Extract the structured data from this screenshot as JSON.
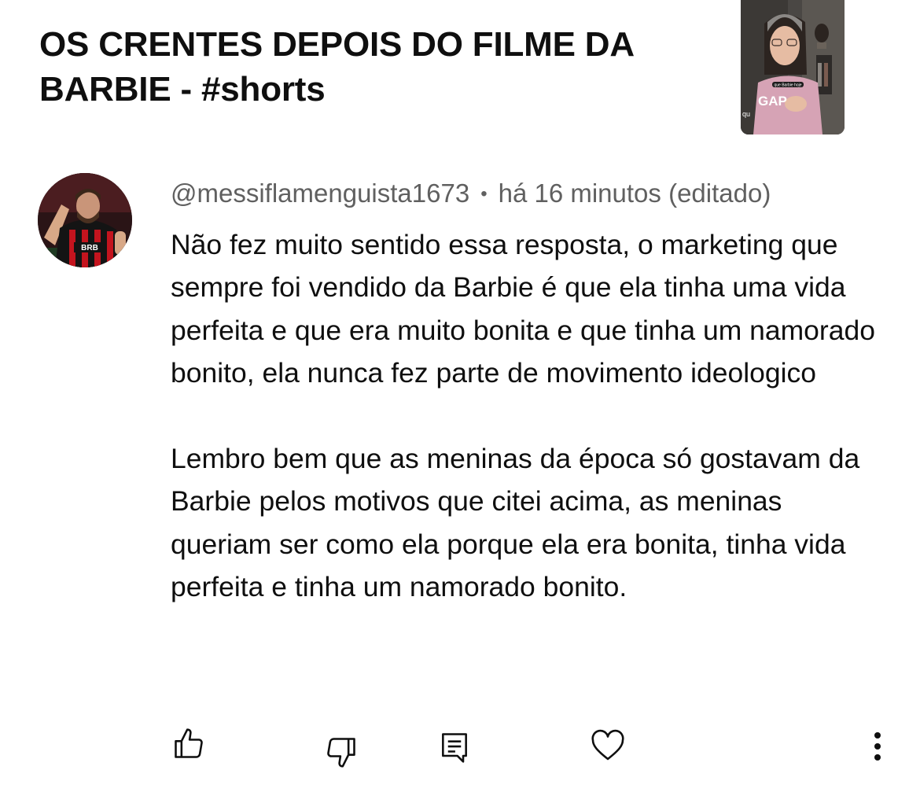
{
  "video": {
    "title": "OS CRENTES DEPOIS DO FILME DA BARBIE - #shorts",
    "thumbnail": {
      "caption": "que Barbie hoje",
      "edge_text": "qu",
      "shirt_text": "GAP"
    }
  },
  "comment": {
    "author": "@messiflamenguista1673",
    "separator": "•",
    "time": "há 16 minutos (editado)",
    "avatar": {
      "shirt_text": "BRB"
    },
    "paragraphs": [
      "Não fez muito sentido essa resposta, o marketing que sempre foi vendido da Barbie é que ela tinha uma vida perfeita e que era muito bonita e que tinha um namorado bonito, ela nunca fez parte de movimento ideologico",
      "Lembro bem que as meninas da época só gostavam da Barbie pelos motivos que citei acima, as meninas queriam ser como ela porque ela era bonita, tinha vida perfeita e tinha um namorado bonito."
    ]
  },
  "actions": {
    "like": "thumbs-up-icon",
    "dislike": "thumbs-down-icon",
    "reply": "comment-icon",
    "heart": "heart-icon",
    "more": "more-vertical-icon"
  },
  "colors": {
    "text_primary": "#0f0f0f",
    "text_secondary": "#606060",
    "background": "#ffffff"
  }
}
